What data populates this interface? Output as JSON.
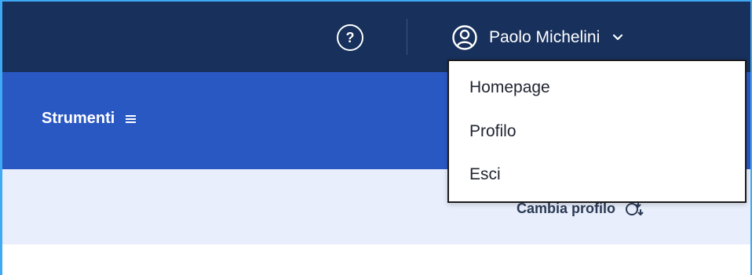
{
  "header": {
    "help_icon": "help-circle-icon",
    "help_glyph": "?",
    "user": {
      "name": "Paolo Michelini",
      "icon": "user-circle-icon",
      "chevron_icon": "chevron-down-icon"
    }
  },
  "user_dropdown": {
    "items": [
      "Homepage",
      "Profilo",
      "Esci"
    ]
  },
  "toolbar": {
    "strumenti_label": "Strumenti",
    "menu_icon": "hamburger-menu-icon"
  },
  "subbar": {
    "cambia_profilo_label": "Cambia profilo",
    "swap_icon": "switch-profile-icon"
  },
  "colors": {
    "topbar": "#17305c",
    "toolbar": "#2a58c3",
    "subbar": "#e8eefb",
    "frame_border": "#3fa9f5"
  }
}
